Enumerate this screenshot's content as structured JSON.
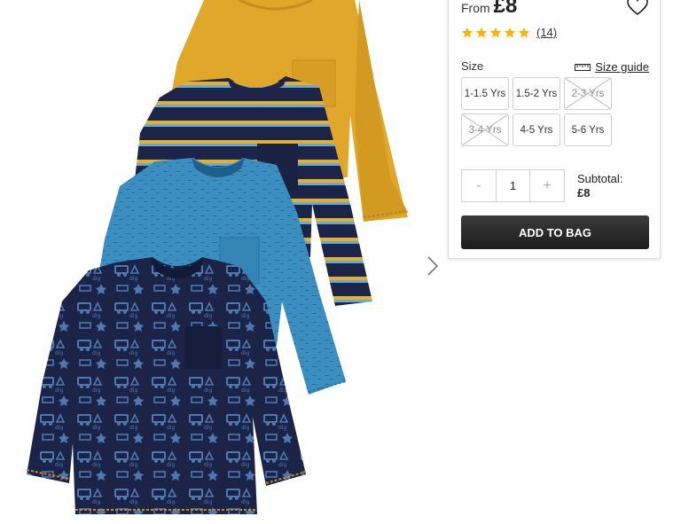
{
  "price": {
    "prefix": "From",
    "value": "£8"
  },
  "rating": {
    "stars": 5,
    "review_count": "(14)",
    "star_color": "#f5b50a"
  },
  "size": {
    "label": "Size",
    "guide_label": "Size guide",
    "options": [
      {
        "label": "1-1.5 Yrs",
        "available": true
      },
      {
        "label": "1.5-2 Yrs",
        "available": true
      },
      {
        "label": "2-3 Yrs",
        "available": false
      },
      {
        "label": "3-4 Yrs",
        "available": false
      },
      {
        "label": "4-5 Yrs",
        "available": true
      },
      {
        "label": "5-6 Yrs",
        "available": true
      }
    ]
  },
  "quantity": {
    "decrement_label": "-",
    "value": "1",
    "increment_label": "+"
  },
  "subtotal": {
    "label": "Subtotal:",
    "amount": "£8"
  },
  "add_to_bag_label": "ADD TO BAG",
  "icons": {
    "wishlist": "heart-outline-icon",
    "size_guide": "ruler-icon",
    "next": "chevron-right-icon"
  },
  "colors": {
    "button_bg": "#262626",
    "shirt_mustard": "#e0a72a",
    "shirt_navy": "#1c2547",
    "shirt_blue": "#3a8ec0"
  }
}
